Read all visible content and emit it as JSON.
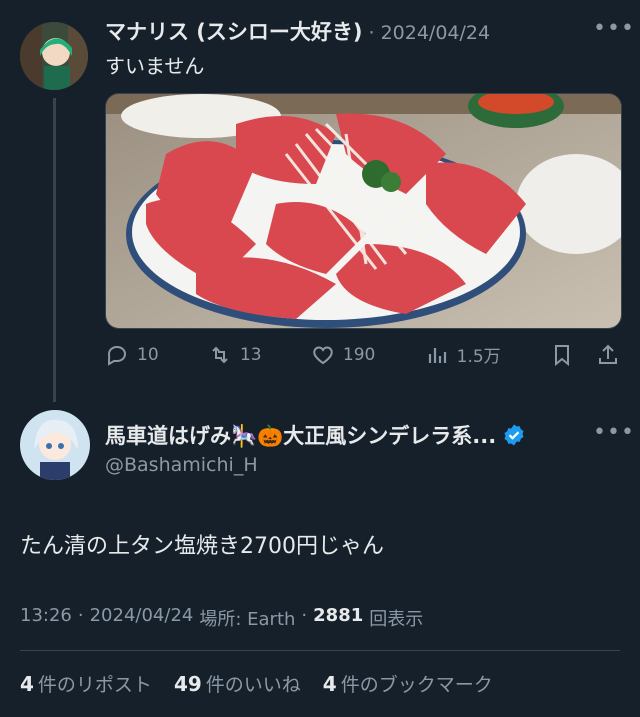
{
  "reply": {
    "name": "マナリス (スシロー大好き)",
    "separator": "·",
    "date": "2024/04/24",
    "text": "すいません",
    "actions": {
      "replies": "10",
      "retweets": "13",
      "likes": "190",
      "views": "1.5万"
    }
  },
  "main": {
    "name": "馬車道はげみ🎠🎃大正風シンデレラ系...",
    "handle": "@Bashamichi_H",
    "text": "たん清の上タン塩焼き2700円じゃん",
    "time": "13:26",
    "date": "2024/04/24",
    "location": "場所: Earth",
    "views_count": "2881",
    "views_label": "回表示",
    "dot": "·"
  },
  "stats": {
    "reposts_count": "4",
    "reposts_label": "件のリポスト",
    "likes_count": "49",
    "likes_label": "件のいいね",
    "bookmarks_count": "4",
    "bookmarks_label": "件のブックマーク"
  },
  "colors": {
    "background": "#15202b",
    "text": "#e7e9ea",
    "muted": "#8b98a5",
    "verified": "#1d9bf0"
  }
}
